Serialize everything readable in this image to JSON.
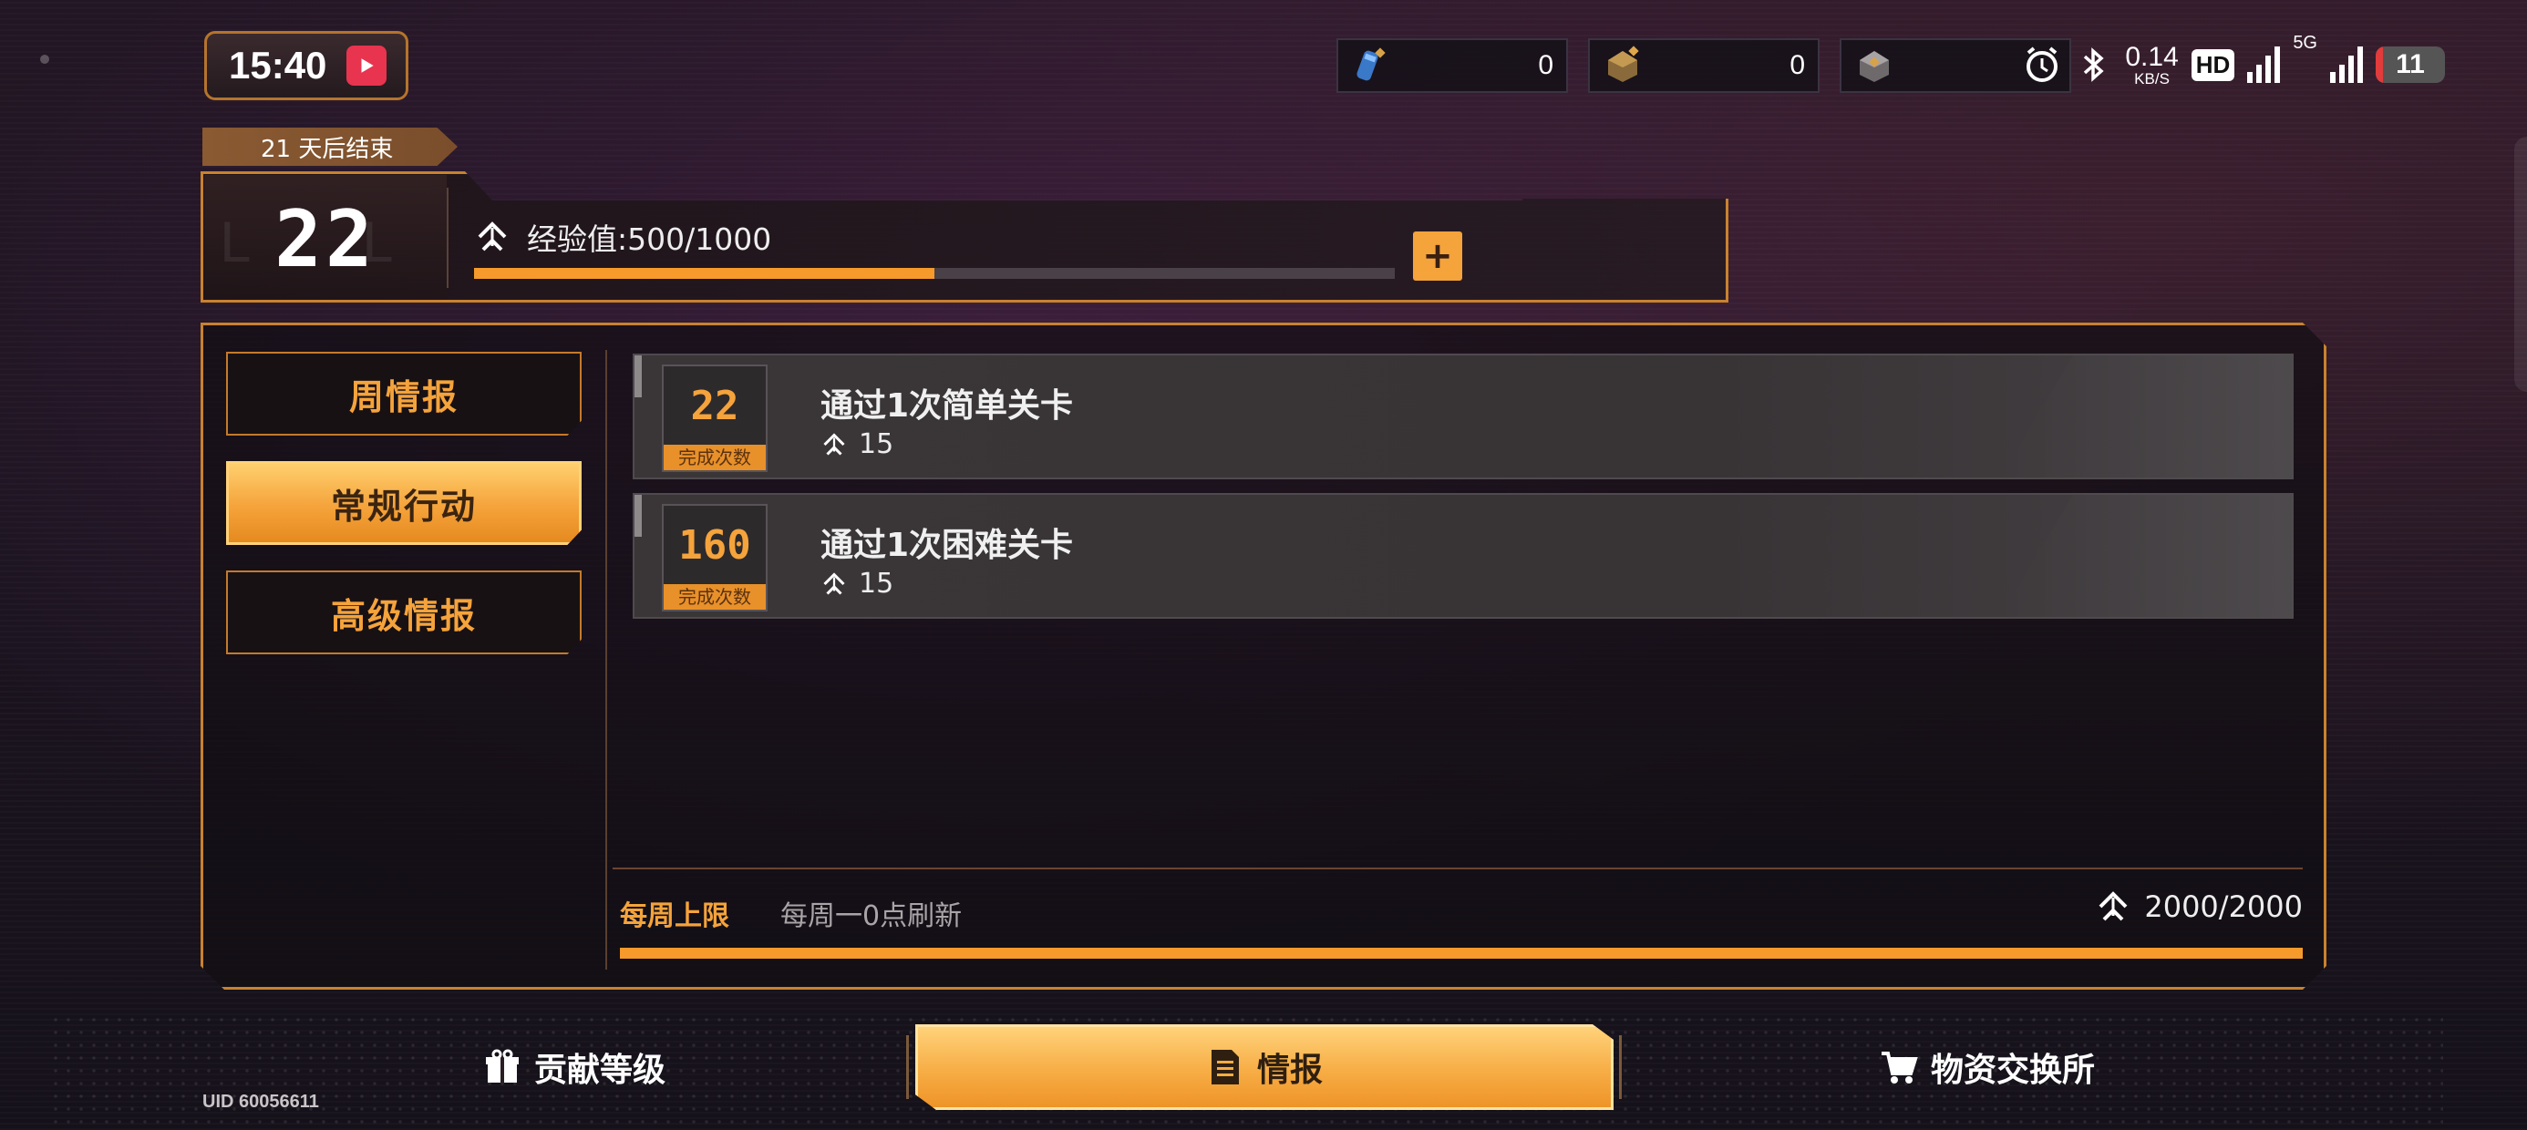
{
  "status": {
    "time": "15:40",
    "resources": [
      {
        "name": "blue-capsule-icon",
        "count": "0"
      },
      {
        "name": "gold-crate-icon",
        "count": "0"
      },
      {
        "name": "gray-crate-icon",
        "count": ""
      }
    ],
    "net_speed": "0.14",
    "net_unit": "KB/S",
    "hd": "HD",
    "net_5g": "5G",
    "battery": "11",
    "battery_level": 0.11
  },
  "season": {
    "ends_in": "21 天后结束",
    "level": "22",
    "xp_label": "经验值:500/1000",
    "xp_current": 500,
    "xp_max": 1000,
    "plus": "+"
  },
  "sidebar": {
    "tabs": [
      {
        "label": "周情报",
        "active": false
      },
      {
        "label": "常规行动",
        "active": true
      },
      {
        "label": "高级情报",
        "active": false
      }
    ]
  },
  "tasks": [
    {
      "count": "22",
      "count_label": "完成次数",
      "title": "通过1次简单关卡",
      "reward": "15"
    },
    {
      "count": "160",
      "count_label": "完成次数",
      "title": "通过1次困难关卡",
      "reward": "15"
    }
  ],
  "weekly_limit": {
    "label": "每周上限",
    "refresh": "每周一0点刷新",
    "value": "2000/2000",
    "progress": 1.0
  },
  "nav": {
    "items": [
      {
        "label": "贡献等级",
        "icon": "gift-icon"
      },
      {
        "label": "情报",
        "icon": "document-icon",
        "active": true
      },
      {
        "label": "物资交换所",
        "icon": "cart-icon"
      }
    ]
  },
  "uid": "UID 60056611",
  "colors": {
    "accent": "#f5a33b",
    "panel_border": "#c8822e",
    "background": "#1c1420"
  }
}
